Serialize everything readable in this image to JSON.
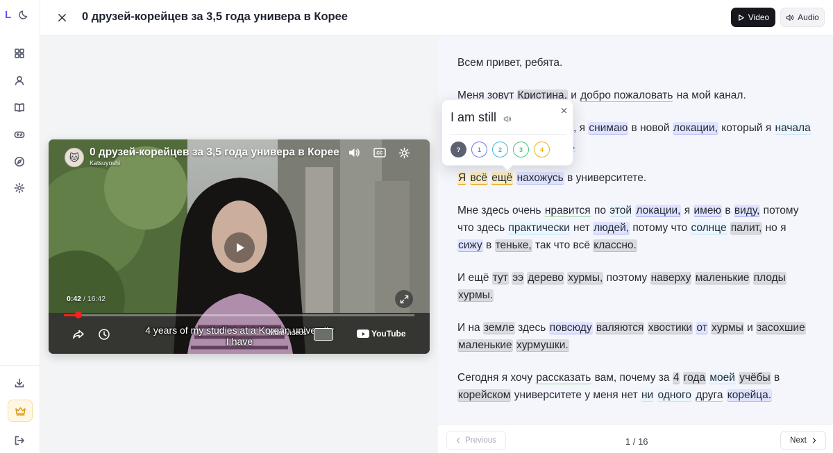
{
  "app": {
    "logo_letter": "L"
  },
  "header": {
    "title": "0 друзей-корейцев за 3,5 года универа в Корее",
    "video_label": "Video",
    "audio_label": "Audio"
  },
  "colors": {
    "accent": "#6d4cff",
    "new_word": "#dadae0",
    "level1": "#dfe3ff",
    "level2": "#eaf6ff",
    "selected": "#fdeec2",
    "progress": "#ff1e1e"
  },
  "video": {
    "title": "0 друзей-корейцев за 3,5 года универа в Корее",
    "channel": "Katsuyoshi",
    "current_time": "0:42",
    "separator": "/",
    "duration": "16:42",
    "progress_fraction": 0.042,
    "caption_line1": "4 years of my studies at a Korean university",
    "caption_line2": "I have",
    "more_videos_label": "More videos",
    "youtube_label": "YouTube",
    "cc_label": "CC"
  },
  "popup": {
    "phrase": "I am still",
    "levels": [
      "?",
      "1",
      "2",
      "3",
      "4"
    ]
  },
  "transcript": [
    [
      {
        "t": "Всем привет, ребята."
      }
    ],
    [
      {
        "t": "Меня зовут "
      },
      {
        "t": "Кристина,",
        "c": "new"
      },
      {
        "t": " и "
      },
      {
        "t": "добро пожаловать",
        "c": "l3"
      },
      {
        "t": " на мой канал."
      }
    ],
    [
      {
        "t": "Я в Корее уже три года,"
      },
      {
        "t": " я "
      },
      {
        "t": "снимаю",
        "c": "l1"
      },
      {
        "t": " в новой "
      },
      {
        "t": "локации,",
        "c": "l1"
      },
      {
        "t": " который я "
      },
      {
        "t": "начала",
        "c": "l2"
      },
      {
        "t": " "
      },
      {
        "t": "относительно",
        "c": "l1"
      },
      {
        "t": " "
      },
      {
        "t": "недавно.",
        "c": "l2"
      }
    ],
    [
      {
        "t": "Я",
        "c": "sel"
      },
      {
        "t": " "
      },
      {
        "t": "всё",
        "c": "sel"
      },
      {
        "t": " "
      },
      {
        "t": "ещё",
        "c": "sel"
      },
      {
        "t": " "
      },
      {
        "t": "нахожусь",
        "c": "l1"
      },
      {
        "t": " в университете."
      }
    ],
    [
      {
        "t": "Мне здесь очень "
      },
      {
        "t": "нравится",
        "c": "l3"
      },
      {
        "t": " по "
      },
      {
        "t": "этой",
        "c": "l2"
      },
      {
        "t": " "
      },
      {
        "t": "локации,",
        "c": "l1"
      },
      {
        "t": " я "
      },
      {
        "t": "имею",
        "c": "l1"
      },
      {
        "t": " в "
      },
      {
        "t": "виду,",
        "c": "l1"
      },
      {
        "t": " потому что здесь "
      },
      {
        "t": "практически",
        "c": "l2"
      },
      {
        "t": " нет "
      },
      {
        "t": "людей,",
        "c": "l1"
      },
      {
        "t": " потому что "
      },
      {
        "t": "солнце",
        "c": "l2"
      },
      {
        "t": " "
      },
      {
        "t": "палит,",
        "c": "new"
      },
      {
        "t": " но я "
      },
      {
        "t": "сижу",
        "c": "l1"
      },
      {
        "t": " в "
      },
      {
        "t": "теньке,",
        "c": "new"
      },
      {
        "t": " так что всё "
      },
      {
        "t": "классно.",
        "c": "new"
      }
    ],
    [
      {
        "t": "И ещё "
      },
      {
        "t": "тут",
        "c": "new"
      },
      {
        "t": " "
      },
      {
        "t": "ээ",
        "c": "new"
      },
      {
        "t": " "
      },
      {
        "t": "дерево",
        "c": "new"
      },
      {
        "t": " "
      },
      {
        "t": "хурмы,",
        "c": "new"
      },
      {
        "t": " поэтому "
      },
      {
        "t": "наверху",
        "c": "new"
      },
      {
        "t": " "
      },
      {
        "t": "маленькие",
        "c": "new"
      },
      {
        "t": " "
      },
      {
        "t": "плоды",
        "c": "new"
      },
      {
        "t": " "
      },
      {
        "t": "хурмы.",
        "c": "new"
      }
    ],
    [
      {
        "t": "И на "
      },
      {
        "t": "земле",
        "c": "new"
      },
      {
        "t": " здесь "
      },
      {
        "t": "повсюду",
        "c": "l1"
      },
      {
        "t": " "
      },
      {
        "t": "валяются",
        "c": "new"
      },
      {
        "t": " "
      },
      {
        "t": "хвостики",
        "c": "new"
      },
      {
        "t": " "
      },
      {
        "t": "от",
        "c": "l1"
      },
      {
        "t": " "
      },
      {
        "t": "хурмы",
        "c": "new"
      },
      {
        "t": " и "
      },
      {
        "t": "засохшие",
        "c": "new"
      },
      {
        "t": " "
      },
      {
        "t": "маленькие",
        "c": "new"
      },
      {
        "t": " "
      },
      {
        "t": "хурмушки.",
        "c": "new"
      }
    ],
    [
      {
        "t": "Сегодня я хочу "
      },
      {
        "t": "рассказать",
        "c": "l3"
      },
      {
        "t": " вам, почему за "
      },
      {
        "t": "4",
        "c": "new"
      },
      {
        "t": " "
      },
      {
        "t": "года",
        "c": "new"
      },
      {
        "t": " "
      },
      {
        "t": "моей",
        "c": "l2"
      },
      {
        "t": " "
      },
      {
        "t": "учёбы",
        "c": "new"
      },
      {
        "t": " в "
      },
      {
        "t": "корейском",
        "c": "new"
      },
      {
        "t": " университете у меня нет "
      },
      {
        "t": "ни",
        "c": "l2"
      },
      {
        "t": " "
      },
      {
        "t": "одного",
        "c": "l2"
      },
      {
        "t": " "
      },
      {
        "t": "друга",
        "c": "l3"
      },
      {
        "t": " "
      },
      {
        "t": "корейца.",
        "c": "l1"
      }
    ]
  ],
  "pager": {
    "prev_label": "Previous",
    "page": "1 / 16",
    "next_label": "Next"
  }
}
